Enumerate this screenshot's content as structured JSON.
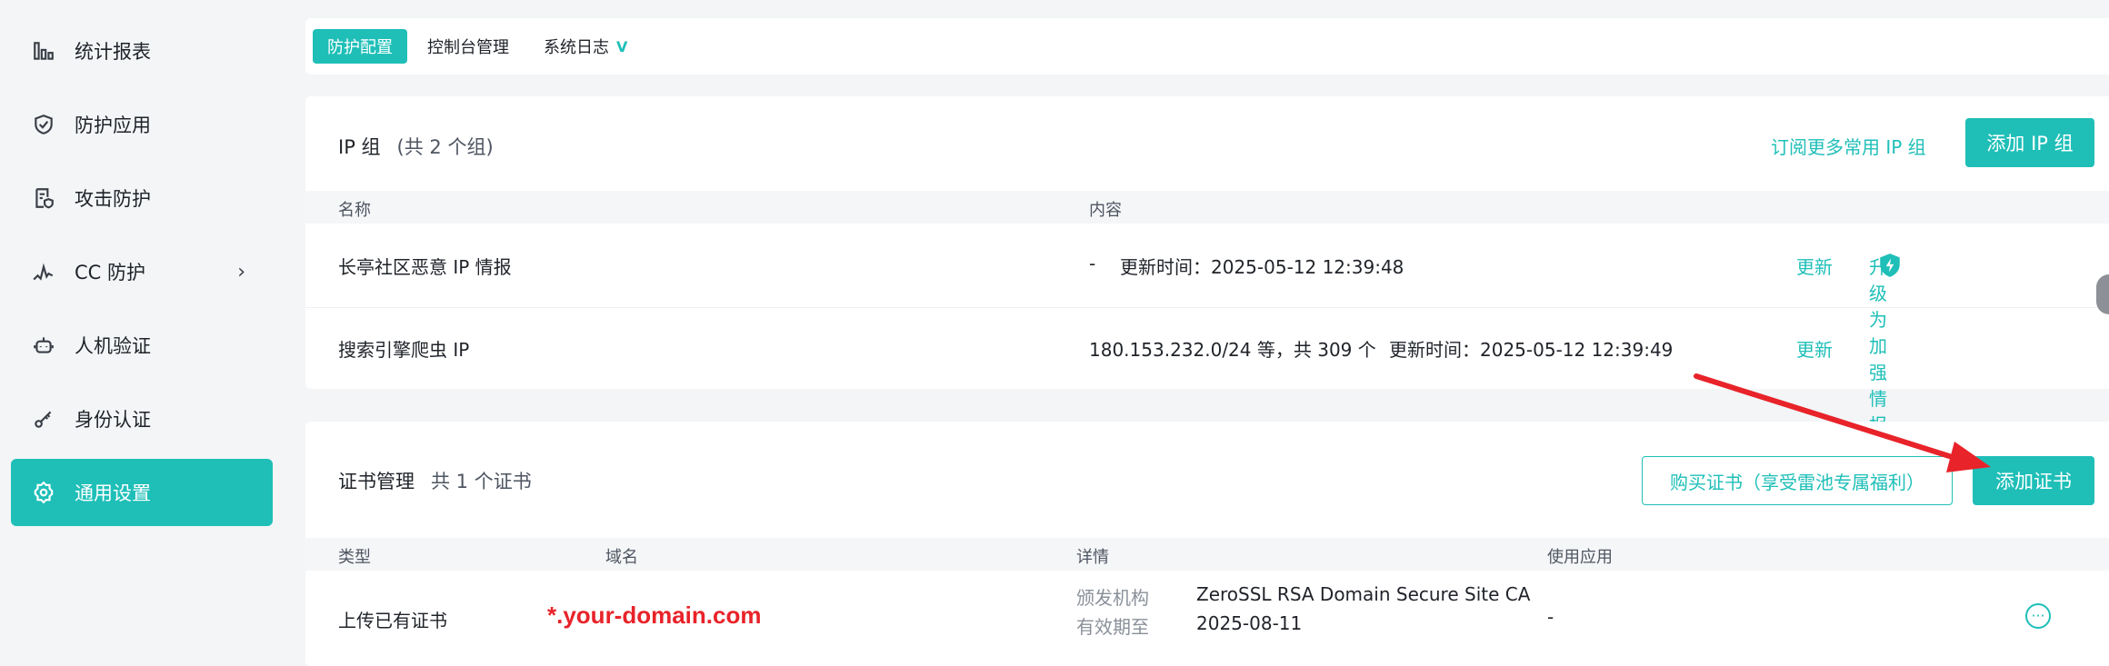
{
  "sidebar": {
    "items": [
      {
        "label": "统计报表",
        "icon": "bar-chart-icon"
      },
      {
        "label": "防护应用",
        "icon": "shield-check-icon"
      },
      {
        "label": "攻击防护",
        "icon": "document-shield-icon"
      },
      {
        "label": "CC 防护",
        "icon": "pulse-icon",
        "arrow": "›"
      },
      {
        "label": "人机验证",
        "icon": "robot-icon"
      },
      {
        "label": "身份认证",
        "icon": "key-icon"
      },
      {
        "label": "通用设置",
        "icon": "gear-icon",
        "active": true
      }
    ]
  },
  "tabs": [
    {
      "label": "防护配置",
      "active": true
    },
    {
      "label": "控制台管理"
    },
    {
      "label": "系统日志",
      "badge": "V"
    }
  ],
  "ip_group": {
    "title": "IP 组",
    "count": "(共 2 个组)",
    "subscribe_link": "订阅更多常用 IP 组",
    "add_button": "添加 IP 组",
    "columns": {
      "name": "名称",
      "content": "内容"
    },
    "rows": [
      {
        "name": "长亭社区恶意 IP 情报",
        "content_prefix": "-",
        "update_time": "更新时间：2025-05-12 12:39:48",
        "action": "更新",
        "upgrade": "升级为加强情报"
      },
      {
        "name": "搜索引擎爬虫 IP",
        "content_prefix": "180.153.232.0/24 等，共 309 个",
        "update_time": "更新时间：2025-05-12 12:39:49",
        "action": "更新"
      }
    ]
  },
  "cert": {
    "title": "证书管理",
    "count": "共 1 个证书",
    "buy_button": "购买证书（享受雷池专属福利）",
    "add_button": "添加证书",
    "columns": {
      "type": "类型",
      "domain": "域名",
      "detail": "详情",
      "apps": "使用应用"
    },
    "rows": [
      {
        "type": "上传已有证书",
        "domain": "*.your-domain.com",
        "issuer_label": "颁发机构",
        "issuer": "ZeroSSL RSA Domain Secure Site CA",
        "expiry_label": "有效期至",
        "expiry": "2025-08-11",
        "apps": "-"
      }
    ]
  },
  "colors": {
    "accent": "#1fbfb8",
    "annotation_arrow": "#e8232a"
  }
}
